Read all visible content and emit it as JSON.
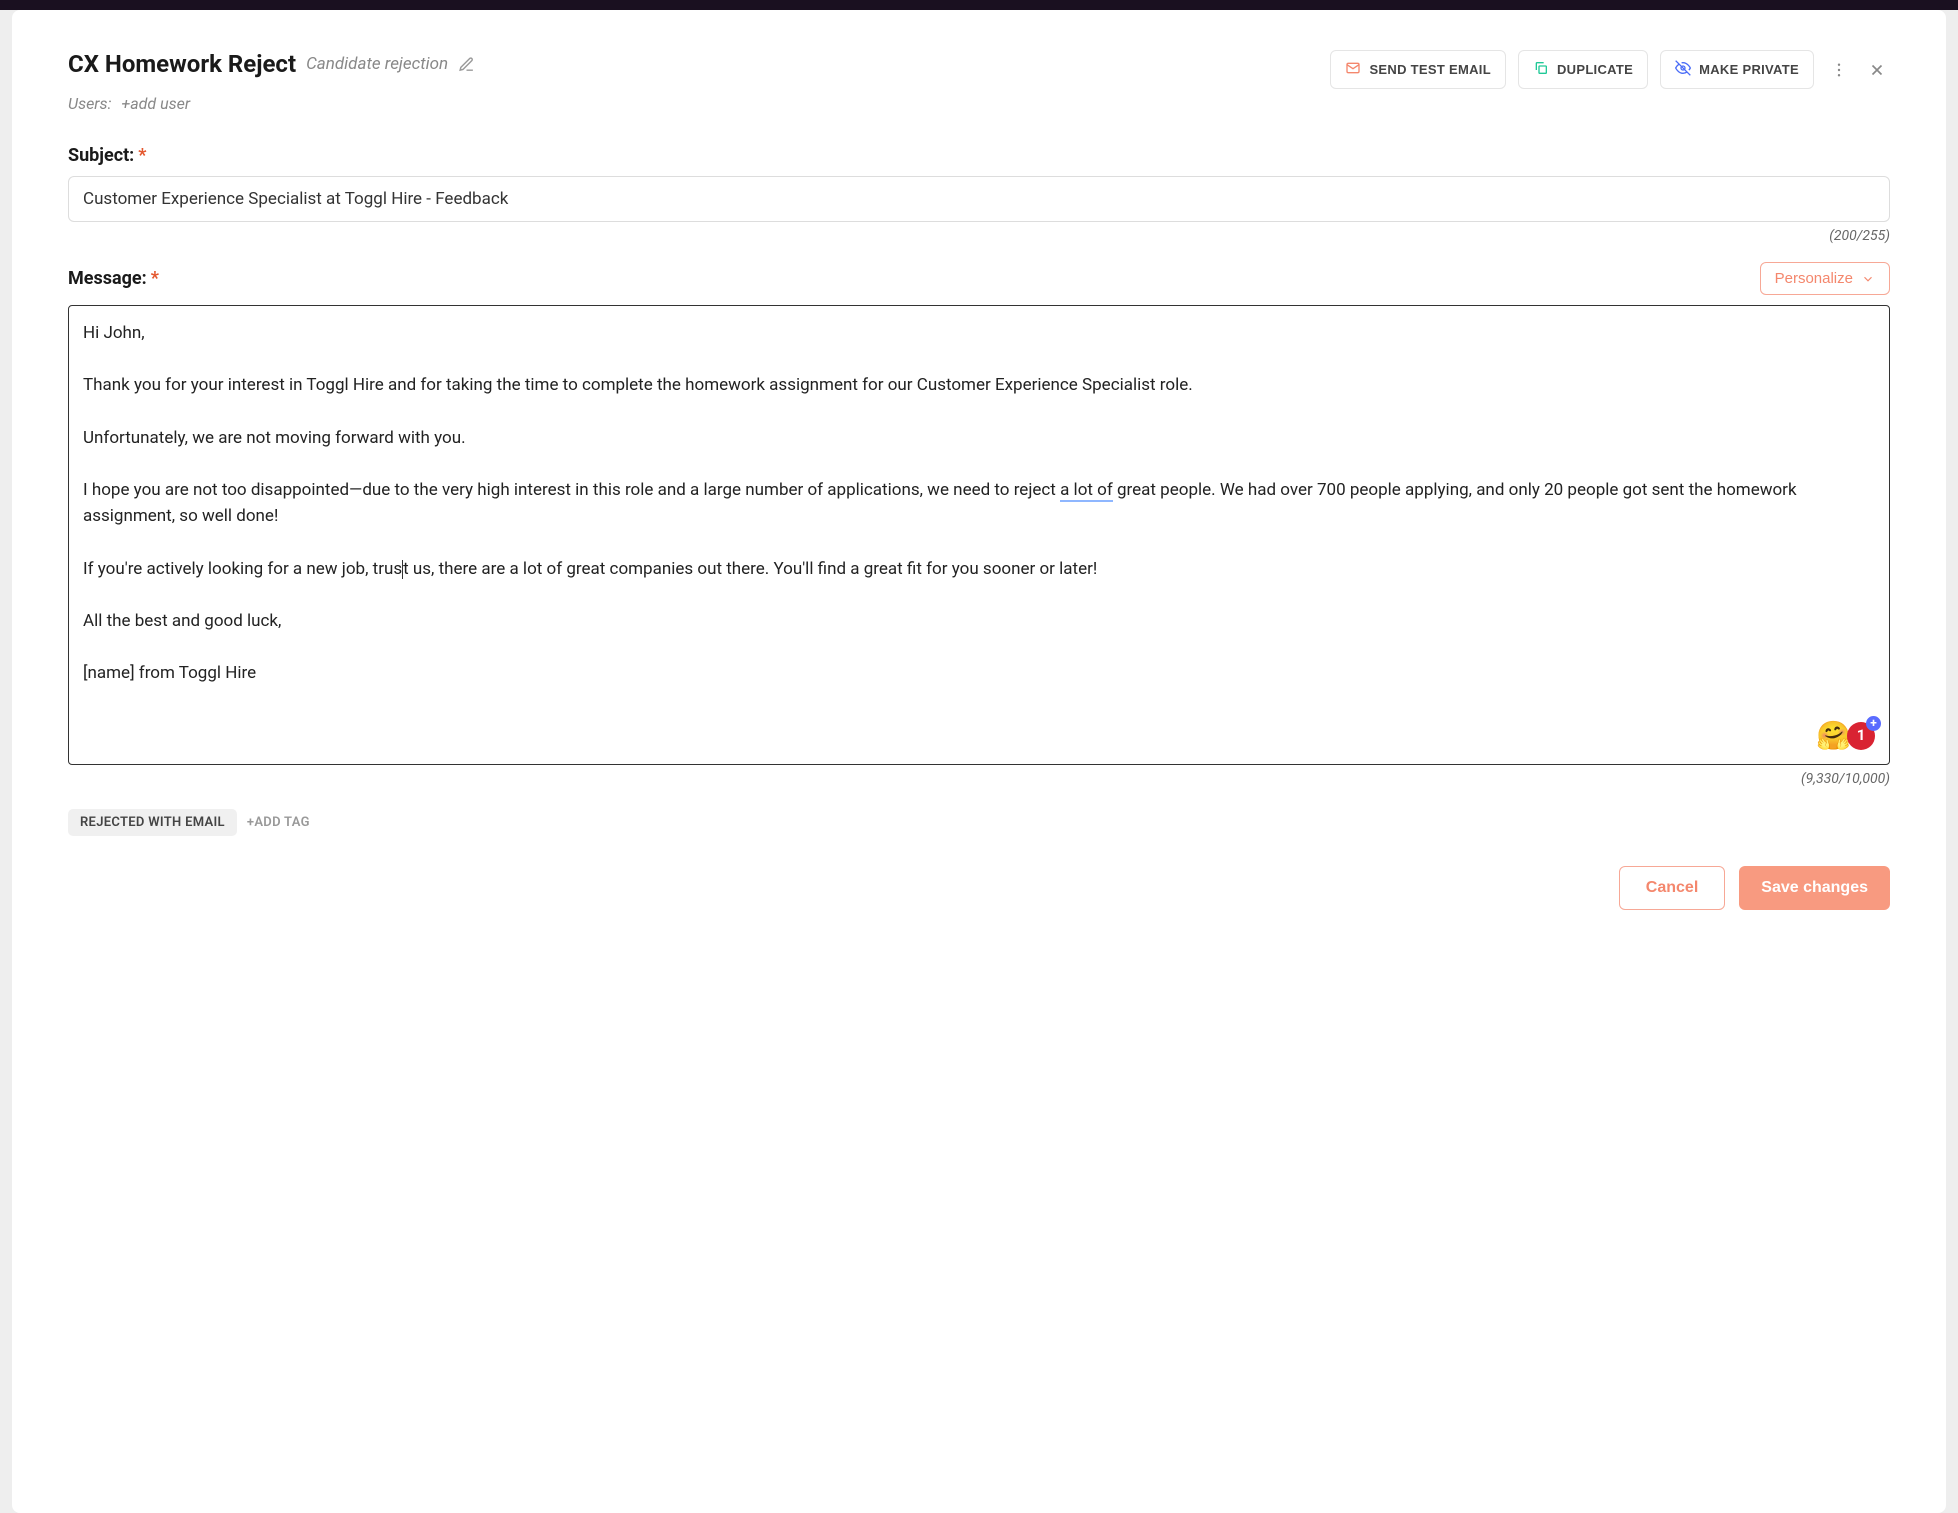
{
  "header": {
    "title": "CX Homework Reject",
    "subtitle": "Candidate rejection",
    "buttons": {
      "send_test": "SEND TEST EMAIL",
      "duplicate": "DUPLICATE",
      "make_private": "MAKE PRIVATE"
    }
  },
  "users": {
    "label": "Users:",
    "add_label": "+add user"
  },
  "subject": {
    "label": "Subject:",
    "value": "Customer Experience Specialist at Toggl Hire - Feedback",
    "counter": "(200/255)"
  },
  "message": {
    "label": "Message:",
    "personalize_label": "Personalize",
    "paragraphs": {
      "greeting": "Hi John,",
      "thanks": "Thank you for your interest in Toggl Hire and for taking the time to complete the homework assignment for our Customer Experience Specialist role.",
      "reject": "Unfortunately, we are not moving forward with you.",
      "hope_pre": "I hope you are not too disappointed—due to the very high interest in this role and a large number of applications, we need to reject ",
      "hope_underlined": "a lot of",
      "hope_post": " great people. We had over 700 people applying, and only 20 people got sent the homework assignment, so well done!",
      "active_pre": "If you're actively looking for a new job, trus",
      "active_post": "t us, there are a lot of great companies out there. You'll find a great fit for you sooner or later!",
      "signoff": "All the best and good luck,",
      "signature": "[name] from Toggl Hire"
    },
    "counter": "(9,330/10,000)",
    "reaction_count": "1"
  },
  "tags": {
    "chip": "REJECTED WITH EMAIL",
    "add_label": "+ADD TAG"
  },
  "footer": {
    "cancel": "Cancel",
    "save": "Save changes"
  }
}
